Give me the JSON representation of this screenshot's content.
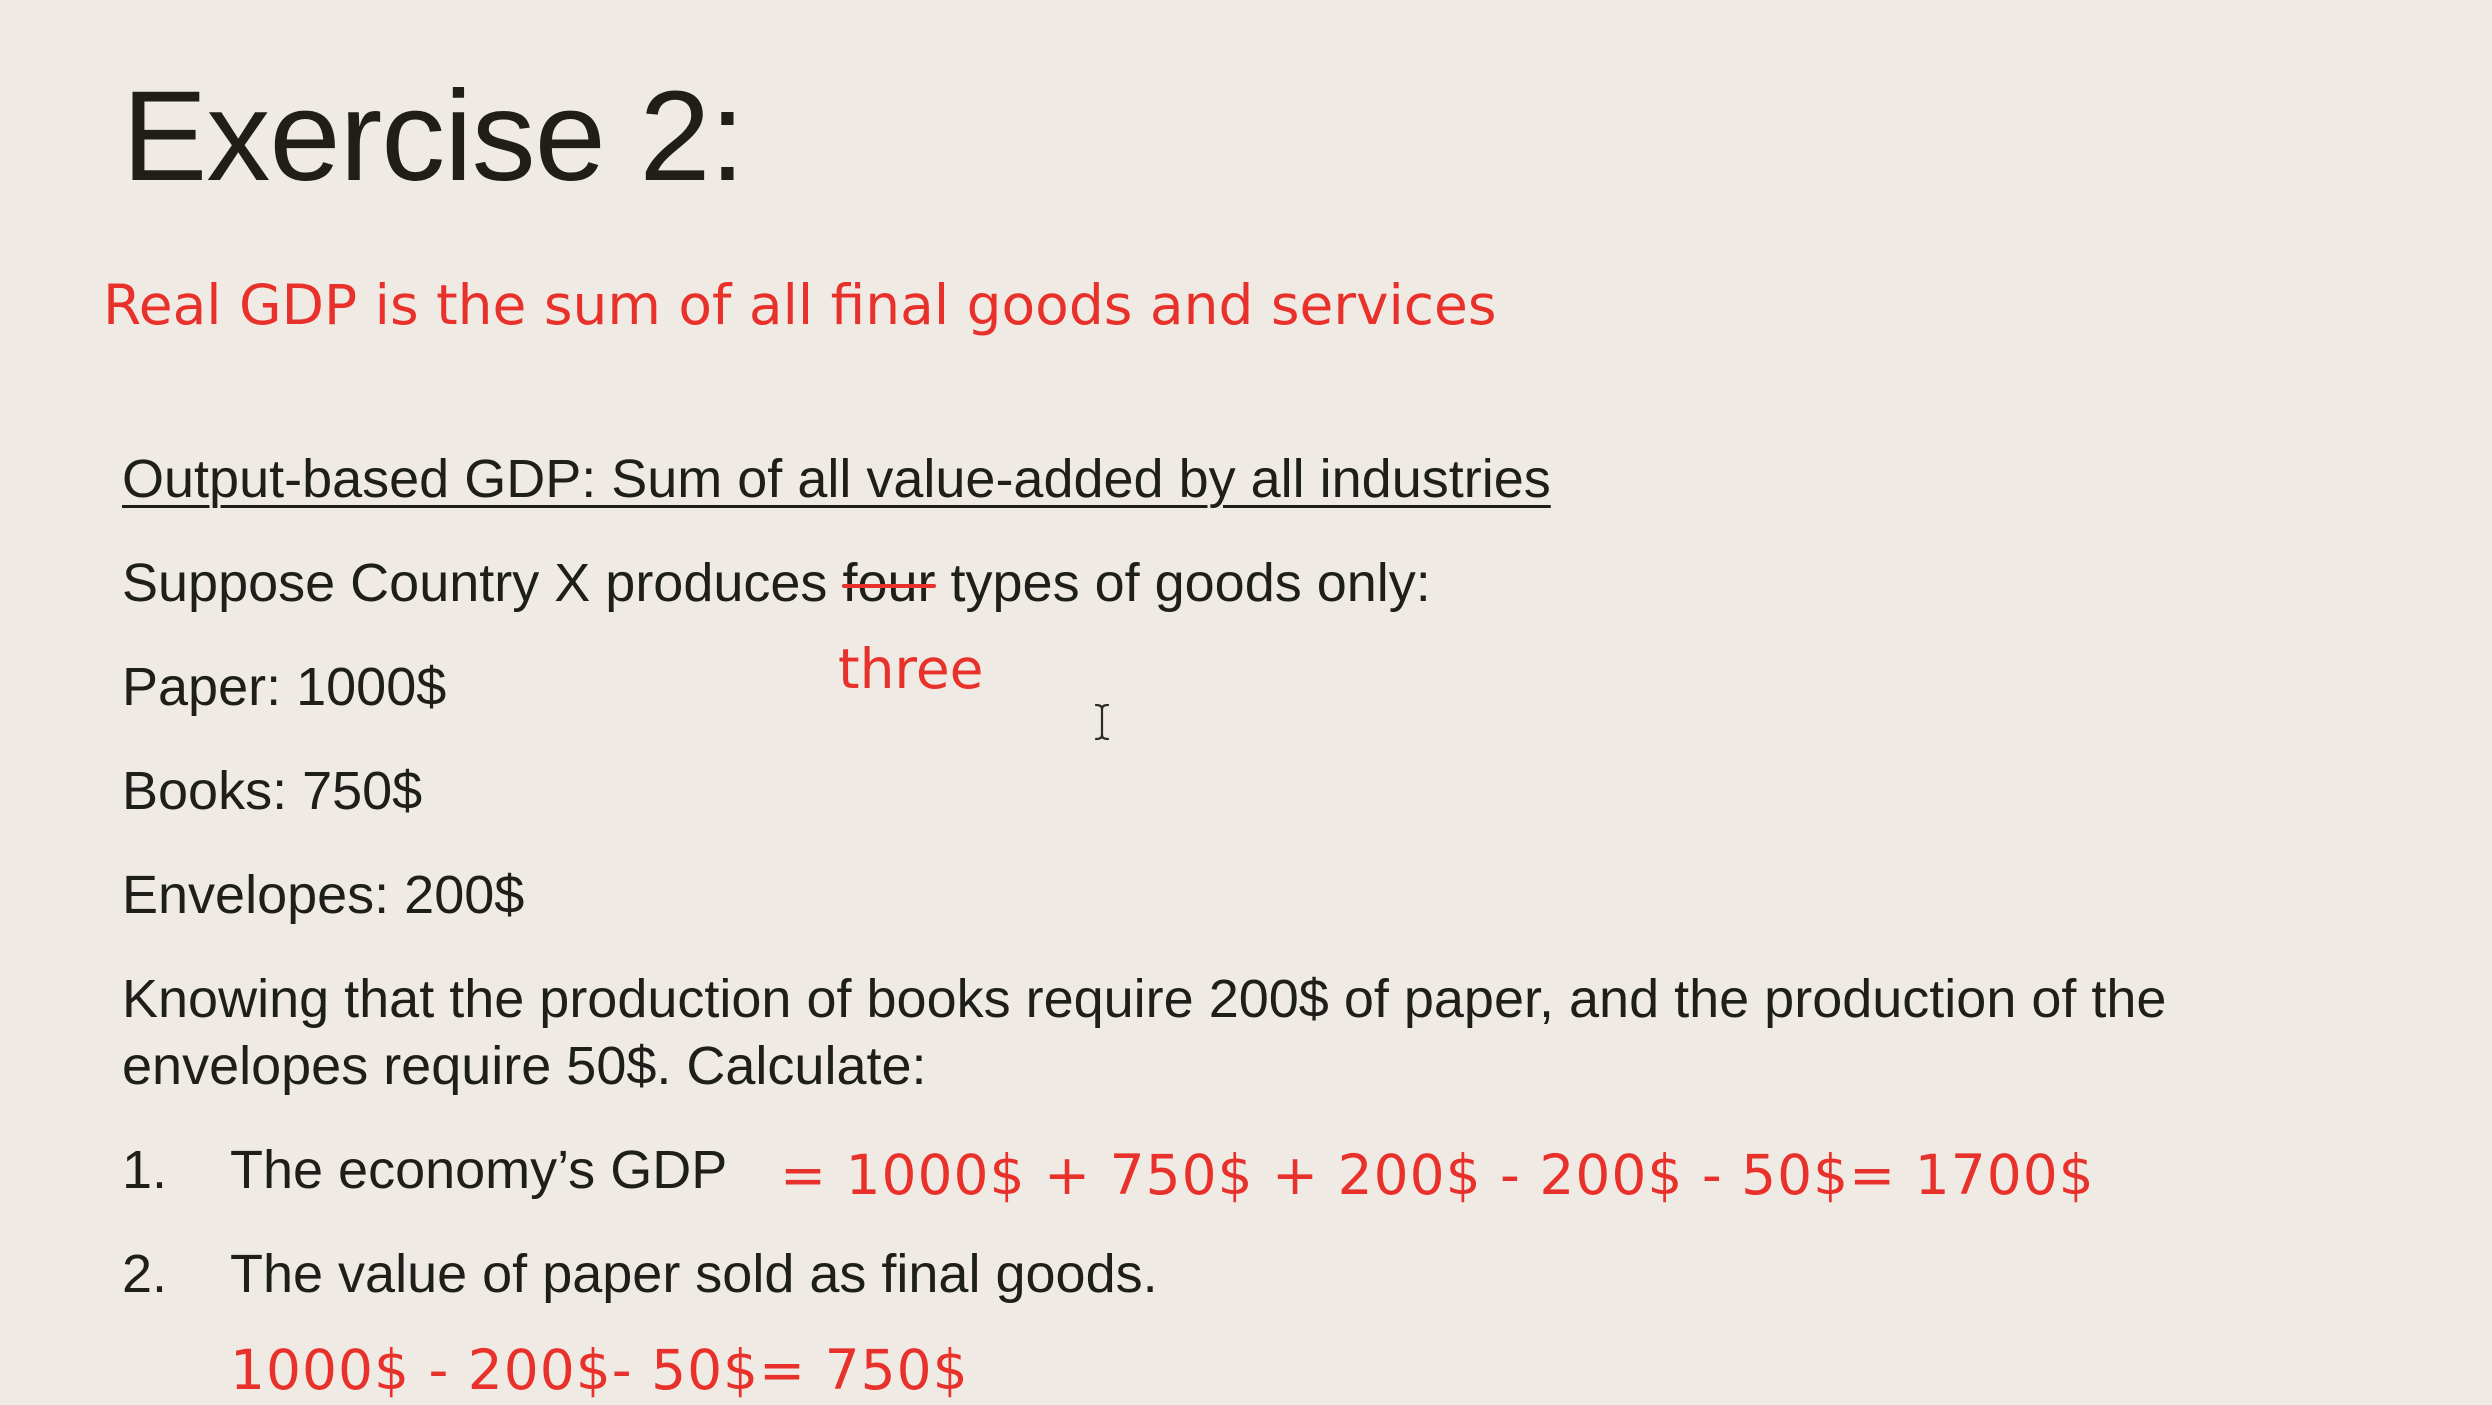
{
  "slide": {
    "title": "Exercise 2:",
    "definition_note": "Real GDP is the sum of all final goods and services",
    "heading": "Output-based GDP: Sum of all value-added by all industries",
    "suppose_before": "Suppose Country X produces ",
    "suppose_struck": "four",
    "suppose_after": " types of goods only:",
    "correction_note": "three",
    "paper_line": "Paper: 1000$",
    "books_line": "Books: 750$",
    "envelopes_line": "Envelopes: 200$",
    "knowing_line_1": "Knowing that the production of books require 200$ of paper, and the production of the",
    "knowing_line_2": "envelopes require 50$. Calculate:",
    "questions": [
      {
        "number": "1.",
        "text": "The economy’s GDP",
        "answer": "= 1000$ + 750$ + 200$ - 200$ - 50$= 1700$"
      },
      {
        "number": "2.",
        "text": "The value of paper sold as final goods.",
        "answer": "1000$ - 200$- 50$= 750$"
      }
    ]
  },
  "colors": {
    "background": "#efebe4",
    "text": "#1e1e1a",
    "annotation": "#e8312a"
  },
  "icons": {
    "cursor": "text-cursor-icon"
  }
}
